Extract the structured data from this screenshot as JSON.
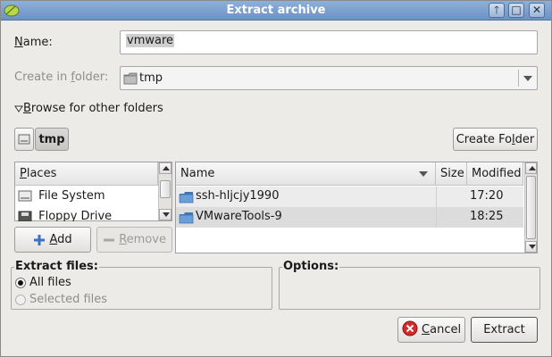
{
  "window": {
    "title": "Extract archive"
  },
  "titlebar": {
    "up_glyph": "🡑",
    "max_glyph": "□",
    "close_glyph": "✕"
  },
  "name_row": {
    "label_pre": "",
    "label_u": "N",
    "label_post": "ame:",
    "value": "vmware"
  },
  "create_in": {
    "label_pre": "Create in ",
    "label_u": "f",
    "label_post": "older:",
    "value": "tmp"
  },
  "browse": {
    "label_u": "B",
    "label_post": "rowse for other folders"
  },
  "path_bar": {
    "current": "tmp"
  },
  "create_folder_button": {
    "pre": "Create Fo",
    "u": "l",
    "post": "der"
  },
  "places": {
    "header_u": "P",
    "header_post": "laces",
    "items": [
      {
        "label": "File System",
        "icon": "drive-icon"
      },
      {
        "label": "Floppy Drive",
        "icon": "floppy-icon"
      }
    ]
  },
  "files": {
    "columns": {
      "name": "Name",
      "size": "Size",
      "modified": "Modified"
    },
    "rows": [
      {
        "name": "ssh-hljcjy1990",
        "size": "",
        "modified": "17:20"
      },
      {
        "name": "VMwareTools-9",
        "size": "",
        "modified": "18:25"
      }
    ]
  },
  "add_button": {
    "u": "A",
    "post": "dd"
  },
  "remove_button": {
    "u": "R",
    "post": "emove"
  },
  "extract_files": {
    "title": "Extract files:",
    "options": [
      {
        "label": "All files",
        "selected": true,
        "enabled": true
      },
      {
        "label": "Selected files",
        "selected": false,
        "enabled": false
      }
    ]
  },
  "options_frame": {
    "title": "Options:"
  },
  "cancel_button": {
    "u": "C",
    "post": "ancel"
  },
  "extract_button": {
    "label": "Extract"
  },
  "colors": {
    "titlebar": "#7a9fcf",
    "folder": "#5b8fd0",
    "cancel_icon": "#d42a2a",
    "add_icon": "#3b72c4"
  }
}
